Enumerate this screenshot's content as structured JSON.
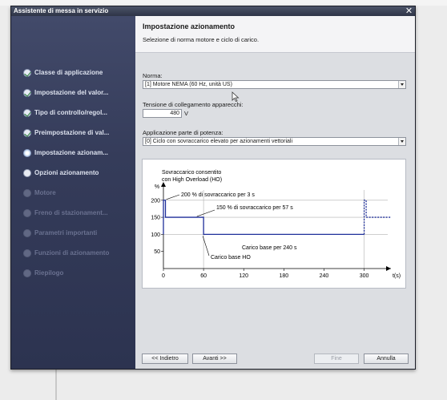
{
  "window": {
    "title": "Assistente di messa in servizio"
  },
  "sidebar": {
    "items": [
      {
        "label": "Classe di applicazione",
        "state": "done"
      },
      {
        "label": "Impostazione del valor...",
        "state": "done"
      },
      {
        "label": "Tipo di controllo/regol...",
        "state": "done"
      },
      {
        "label": "Preimpostazione di val...",
        "state": "done"
      },
      {
        "label": "Impostazione azionam...",
        "state": "active"
      },
      {
        "label": "Opzioni azionamento",
        "state": "pending"
      },
      {
        "label": "Motore",
        "state": "disabled"
      },
      {
        "label": "Freno di stazionament...",
        "state": "disabled"
      },
      {
        "label": "Parametri importanti",
        "state": "disabled"
      },
      {
        "label": "Funzioni di azionamento",
        "state": "disabled"
      },
      {
        "label": "Riepilogo",
        "state": "disabled"
      }
    ]
  },
  "header": {
    "title": "Impostazione azionamento",
    "subtitle": "Selezione di norma motore e ciclo di carico."
  },
  "form": {
    "norm_label": "Norma:",
    "norm_value": "[1] Motore NEMA (60 Hz, unità US)",
    "voltage_label": "Tensione di collegamento apparecchi:",
    "voltage_value": "480",
    "voltage_unit": "V",
    "power_label": "Applicazione parte di potenza:",
    "power_value": "[0] Ciclo con sovraccarico elevato per azionamenti vettoriali"
  },
  "chart_data": {
    "type": "line",
    "title": "Sovraccarico consentito\ncon High Overload (HO)",
    "ylabel": "%",
    "xlabel": "t(s)",
    "xticks": [
      0,
      60,
      120,
      180,
      240,
      300
    ],
    "yticks": [
      50,
      100,
      150,
      200
    ],
    "xlim": [
      0,
      340
    ],
    "ylim": [
      0,
      230
    ],
    "series": [
      {
        "x": [
          0,
          0,
          3,
          3,
          60,
          60,
          300
        ],
        "y": [
          100,
          200,
          200,
          150,
          150,
          100,
          100
        ],
        "style": "solid"
      },
      {
        "x": [
          300,
          300,
          303,
          303,
          340
        ],
        "y": [
          100,
          200,
          200,
          150,
          150
        ],
        "style": "dashed"
      }
    ],
    "annotations": [
      {
        "text": "200 % di sovraccarico per 3 s"
      },
      {
        "text": "150 % di sovraccarico per 57 s"
      },
      {
        "text": "Carico base per 240 s"
      },
      {
        "text": "Carico base HO"
      }
    ],
    "colors": {
      "curve": "#1f2f9a",
      "grid": "#b0b0b0",
      "axis": "#000000"
    }
  },
  "buttons": {
    "back": "<< Indietro",
    "next": "Avanti >>",
    "finish": "Fine",
    "cancel": "Annulla"
  }
}
